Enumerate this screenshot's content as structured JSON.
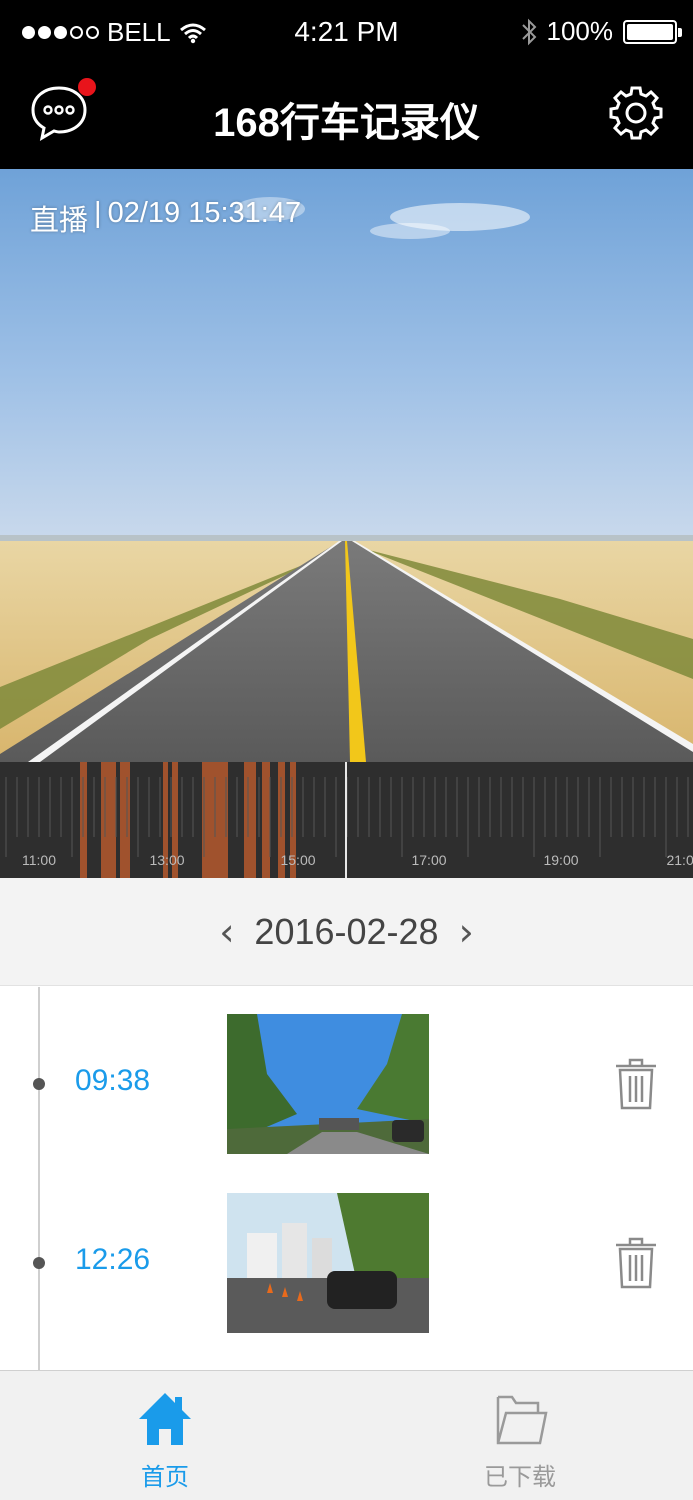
{
  "status_bar": {
    "carrier": "BELL",
    "time": "4:21 PM",
    "battery": "100%",
    "battery_level": 1.0
  },
  "nav": {
    "title": "168行车记录仪",
    "message_icon": "chat-bubble-icon",
    "settings_icon": "gear-icon",
    "has_notification": true
  },
  "live": {
    "label": "直播",
    "separator": "|",
    "datetime": "02/19 15:31:47"
  },
  "timeline": {
    "ticks": [
      "11:00",
      "13:00",
      "15:00",
      "17:00",
      "19:00",
      "21:00"
    ],
    "highlight_color": "#a0522d"
  },
  "date_nav": {
    "date": "2016-02-28",
    "prev": "‹",
    "next": "›"
  },
  "recordings": [
    {
      "time": "09:38",
      "thumbnail": "tunnel-road-thumbnail"
    },
    {
      "time": "12:26",
      "thumbnail": "city-street-thumbnail"
    }
  ],
  "tabs": [
    {
      "label": "首页",
      "icon": "home-icon",
      "active": true
    },
    {
      "label": "已下载",
      "icon": "folder-icon",
      "active": false
    }
  ],
  "colors": {
    "accent": "#1a9bea",
    "bar_bg": "#000000",
    "inactive": "#9a9a9a"
  }
}
